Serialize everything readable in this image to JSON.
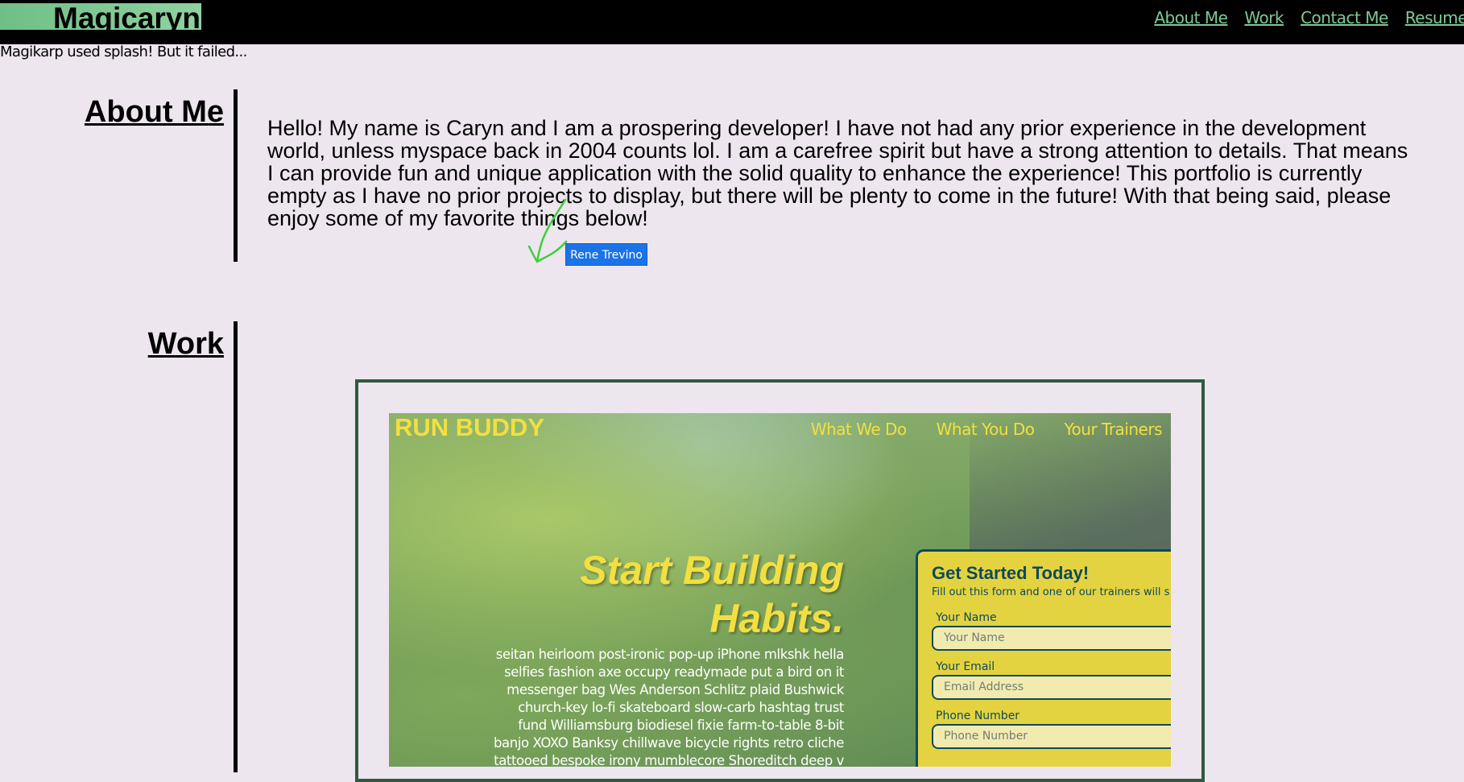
{
  "header": {
    "brand": "Magicaryn",
    "nav": [
      "About Me",
      "Work",
      "Contact Me",
      "Resume"
    ]
  },
  "tagline": "Magikarp used splash! But it failed...",
  "about": {
    "title": "About Me",
    "text": "Hello! My name is Caryn and I am a prospering developer! I have not had any prior experience in the development world, unless myspace back in 2004 counts lol. I am a carefree spirit but have a strong attention to details. That means I can provide fun and unique application with the solid quality to enhance the experience! This portfolio is currently empty as I have no prior projects to display, but there will be plenty to come in the future! With that being said, please enjoy some of my favorite things below!"
  },
  "annotation": {
    "label": "Rene Trevino"
  },
  "work": {
    "title": "Work",
    "preview": {
      "logo": "RUN BUDDY",
      "nav": [
        "What We Do",
        "What You Do",
        "Your Trainers"
      ],
      "hero_title": "Start Building Habits.",
      "hero_text": "seitan heirloom post-ironic pop-up iPhone mlkshk hella selfies fashion axe occupy readymade put a bird on it messenger bag Wes Anderson Schlitz plaid Bushwick church-key lo-fi skateboard slow-carb hashtag trust fund Williamsburg biodiesel fixie farm-to-table 8-bit banjo XOXO Banksy chillwave bicycle rights retro cliche tattooed bespoke irony mumblecore Shoreditch deep v",
      "form": {
        "title": "Get Started Today!",
        "subtitle": "Fill out this form and one of our trainers will s",
        "fields": [
          {
            "label": "Your Name",
            "placeholder": "Your Name"
          },
          {
            "label": "Your Email",
            "placeholder": "Email Address"
          },
          {
            "label": "Phone Number",
            "placeholder": "Phone Number"
          }
        ]
      }
    }
  },
  "colors": {
    "header_bg": "#000000",
    "brand_bg": "#7ec995",
    "nav_link": "#7ec995",
    "page_bg": "#ede6ee",
    "frame_border": "#2f5a40",
    "runbuddy_yellow": "#f3df42",
    "runbuddy_teal": "#0d4a5a",
    "annotation_blue": "#1a73e8",
    "annotation_stroke": "#3ccf3c"
  }
}
